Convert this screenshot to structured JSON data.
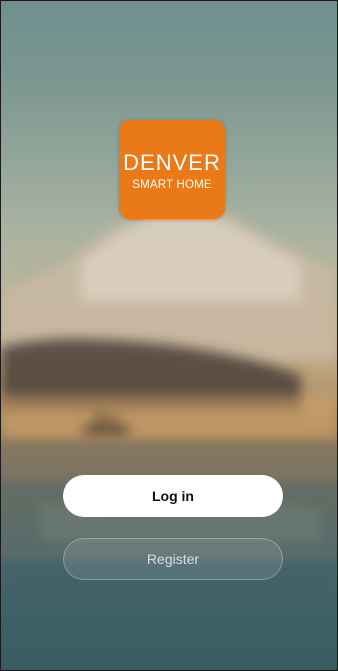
{
  "logo": {
    "brand": "DENVER",
    "subtitle": "SMART HOME",
    "color": "#ea7a17"
  },
  "actions": {
    "login_label": "Log in",
    "register_label": "Register"
  }
}
